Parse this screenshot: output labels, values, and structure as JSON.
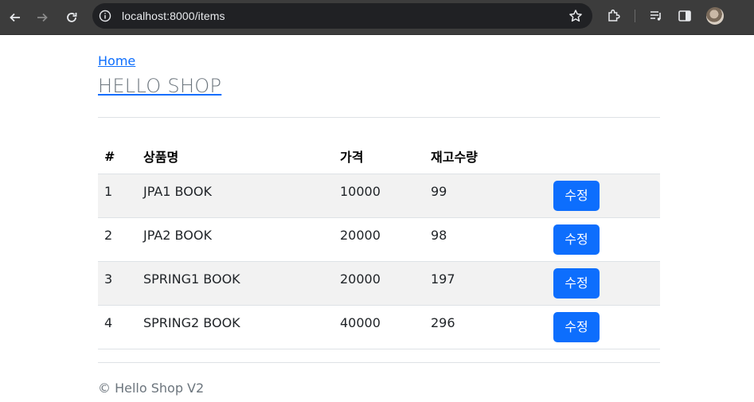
{
  "browser": {
    "url": "localhost:8000/items"
  },
  "nav": {
    "home_label": "Home",
    "title": "HELLO SHOP"
  },
  "table": {
    "headers": [
      "#",
      "상품명",
      "가격",
      "재고수량",
      ""
    ],
    "rows": [
      {
        "id": "1",
        "name": "JPA1 BOOK",
        "price": "10000",
        "stock": "99",
        "action": "수정"
      },
      {
        "id": "2",
        "name": "JPA2 BOOK",
        "price": "20000",
        "stock": "98",
        "action": "수정"
      },
      {
        "id": "3",
        "name": "SPRING1 BOOK",
        "price": "20000",
        "stock": "197",
        "action": "수정"
      },
      {
        "id": "4",
        "name": "SPRING2 BOOK",
        "price": "40000",
        "stock": "296",
        "action": "수정"
      }
    ]
  },
  "footer": {
    "text": "© Hello Shop V2"
  },
  "colors": {
    "primary": "#0d6efd",
    "stripe": "#f2f2f2",
    "chrome_bg": "#3c3c3c"
  },
  "icons": [
    "back-arrow-icon",
    "forward-arrow-icon",
    "reload-icon",
    "site-info-icon",
    "bookmark-star-icon",
    "extensions-icon",
    "reading-list-icon",
    "side-panel-icon"
  ]
}
